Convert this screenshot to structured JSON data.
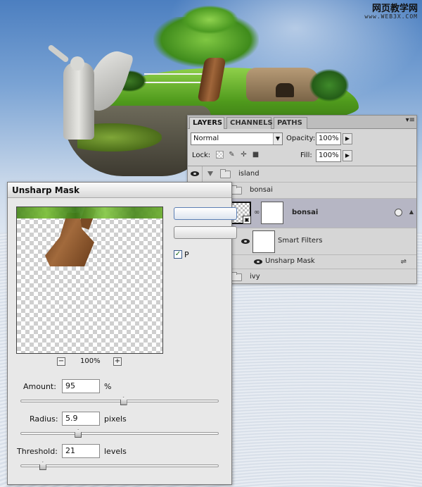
{
  "watermark": {
    "cn": "网页教学网",
    "url": "www.WEB3X.COM"
  },
  "layers_panel": {
    "tabs": [
      "LAYERS",
      "CHANNELS",
      "PATHS"
    ],
    "menu_icon": "▾≡",
    "blend_mode": "Normal",
    "opacity_label": "Opacity:",
    "opacity_value": "100%",
    "lock_label": "Lock:",
    "fill_label": "Fill:",
    "fill_value": "100%",
    "layers": {
      "island": "island",
      "bonsai_group": "bonsai",
      "bonsai_layer": "bonsai",
      "smart_filters": "Smart Filters",
      "unsharp_mask": "Unsharp Mask",
      "ivy": "ivy"
    }
  },
  "dialog": {
    "title": "Unsharp Mask",
    "zoom_level": "100%",
    "zoom_out": "−",
    "zoom_in": "+",
    "preview_label": "P",
    "amount": {
      "label": "Amount:",
      "value": "95",
      "unit": "%",
      "slider_fraction": 0.52
    },
    "radius": {
      "label": "Radius:",
      "value": "5.9",
      "unit": "pixels",
      "slider_fraction": 0.29
    },
    "threshold": {
      "label": "Threshold:",
      "value": "21",
      "unit": "levels",
      "slider_fraction": 0.11
    }
  },
  "colors": {
    "selected_layer": "#b6b6c4",
    "panel_bg": "#d6d6d6",
    "dialog_bg": "#e8e8e8"
  }
}
